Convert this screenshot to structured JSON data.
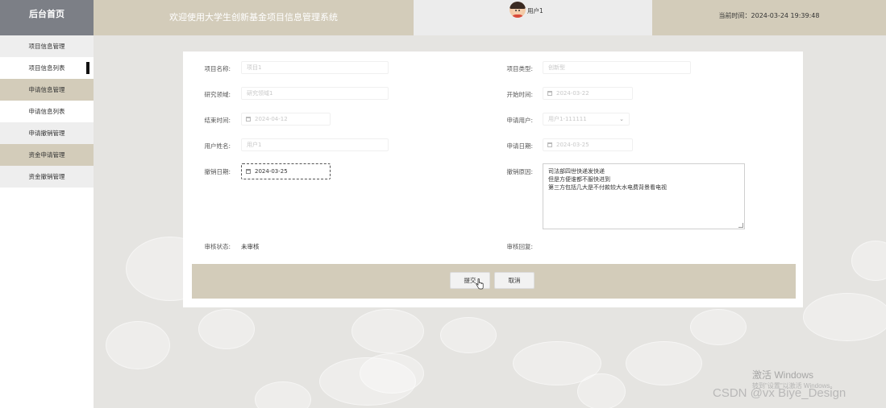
{
  "header": {
    "brand": "后台首页",
    "title": "欢迎使用大学生创新基金项目信息管理系统",
    "user_name": "用户1",
    "time_text": "当前时间：2024-03-24 19:39:48"
  },
  "sidebar": {
    "items": [
      {
        "label": "项目信息管理"
      },
      {
        "label": "项目信息列表"
      },
      {
        "label": "申请信息管理"
      },
      {
        "label": "申请信息列表"
      },
      {
        "label": "申请撤销管理"
      },
      {
        "label": "资金申请管理"
      },
      {
        "label": "资金撤销管理"
      }
    ]
  },
  "form": {
    "project_name": {
      "label": "项目名称:",
      "placeholder": "项目1"
    },
    "project_type": {
      "label": "项目类型:",
      "placeholder": "创新型"
    },
    "research_area": {
      "label": "研究领域:",
      "placeholder": "研究领域1"
    },
    "start_time": {
      "label": "开始时间:",
      "value": "2024-03-22"
    },
    "end_time": {
      "label": "结束时间:",
      "value": "2024-04-12"
    },
    "apply_user": {
      "label": "申请用户:",
      "value": "用户1-111111"
    },
    "user_name": {
      "label": "用户姓名:",
      "placeholder": "用户1"
    },
    "apply_date": {
      "label": "申请日期:",
      "value": "2024-03-25"
    },
    "cancel_date": {
      "label": "撤销日期:",
      "value": "2024-03-25"
    },
    "cancel_reason": {
      "label": "撤销原因:",
      "lines": [
        "司法部四世快递发快递",
        "但是方便谁都不服快进到",
        "第三方包括几大是不付款较大水电费背景看电视"
      ]
    },
    "review_status": {
      "label": "审核状态:",
      "value": "未审核"
    },
    "review_reply": {
      "label": "审核回复:"
    }
  },
  "buttons": {
    "submit": "提交",
    "cancel": "取消"
  },
  "watermarks": {
    "activate_title": "激活 Windows",
    "activate_sub": "转到\"设置\"以激活 Windows。",
    "csdn": "CSDN @vx Biye_Design"
  },
  "colors": {
    "accent_tan": "#d3ccba",
    "brand_grey": "#7c7f86"
  }
}
